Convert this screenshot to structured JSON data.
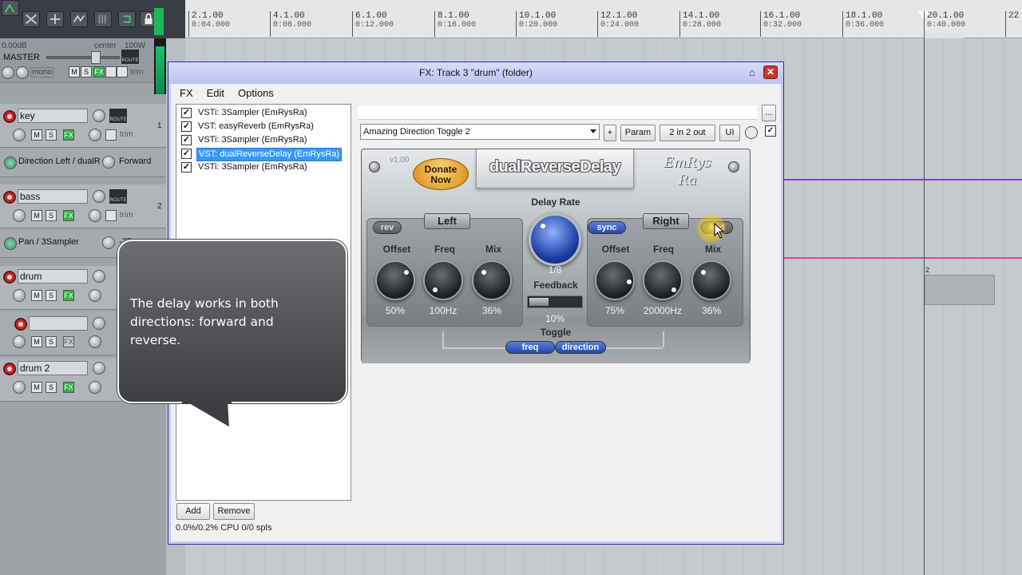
{
  "ruler": {
    "marks": [
      {
        "bar": "2.1.00",
        "time": "0:04.000"
      },
      {
        "bar": "4.1.00",
        "time": "0:08.000"
      },
      {
        "bar": "6.1.00",
        "time": "0:12.000"
      },
      {
        "bar": "8.1.00",
        "time": "0:16.000"
      },
      {
        "bar": "10.1.00",
        "time": "0:20.000"
      },
      {
        "bar": "12.1.00",
        "time": "0:24.000"
      },
      {
        "bar": "14.1.00",
        "time": "0:28.000"
      },
      {
        "bar": "16.1.00",
        "time": "0:32.000"
      },
      {
        "bar": "18.1.00",
        "time": "0:36.000"
      },
      {
        "bar": "20.1.00",
        "time": "0:40.000"
      },
      {
        "bar": "22",
        "time": ""
      }
    ]
  },
  "tracks": {
    "master": {
      "volume": "0.00dB",
      "pan": "center",
      "width": "100W",
      "name": "MASTER",
      "mono_label": "mono",
      "m_label": "M",
      "s_label": "S",
      "fx_label": "FX",
      "trim_label": "trim"
    },
    "key": {
      "name": "key",
      "number": "1"
    },
    "key_env": {
      "label": "Direction Left / dualR",
      "value": "Forward"
    },
    "bass": {
      "name": "bass",
      "number": "2"
    },
    "bass_env": {
      "label": "Pan / 3Sampler",
      "value": "-77"
    },
    "drum": {
      "name": "drum"
    },
    "unnamed": {
      "name": ""
    },
    "drum2": {
      "name": "drum 2"
    },
    "buttons": {
      "m": "M",
      "s": "S",
      "fx": "FX",
      "trim": "trim",
      "route": "ROUTE"
    },
    "item_number": "2"
  },
  "fxwindow": {
    "title": "FX: Track 3 \"drum\" (folder)",
    "pin_icon": "pin-icon",
    "close_label": "✕",
    "menu": [
      "FX",
      "Edit",
      "Options"
    ],
    "fx_chain": [
      {
        "label": "VSTi: 3Sampler (EmRysRa)",
        "checked": true,
        "selected": false
      },
      {
        "label": "VST: easyReverb (EmRysRa)",
        "checked": true,
        "selected": false
      },
      {
        "label": "VSTi: 3Sampler (EmRysRa)",
        "checked": true,
        "selected": false
      },
      {
        "label": "VST: dualReverseDelay (EmRysRa)",
        "checked": true,
        "selected": true
      },
      {
        "label": "VSTi: 3Sampler (EmRysRa)",
        "checked": true,
        "selected": false
      }
    ],
    "add_label": "Add",
    "remove_label": "Remove",
    "cpu": "0.0%/0.2% CPU 0/0 spls",
    "more_label": "...",
    "preset": "Amazing Direction Toggle 2",
    "plus_label": "+",
    "param_label": "Param",
    "io_label": "2 in 2 out",
    "ui_label": "UI",
    "bypass_check": "✓"
  },
  "plugin": {
    "version": "v1.00",
    "donate": "Donate Now",
    "title": "dualReverseDelay",
    "brand": "EmRys Ra",
    "delay_rate_label": "Delay Rate",
    "delay_rate_value": "1/8",
    "feedback_label": "Feedback",
    "feedback_value": "10%",
    "toggle_label": "Toggle",
    "toggle_freq": "freq",
    "toggle_direction": "direction",
    "left": {
      "title": "Left",
      "rev_label": "rev",
      "offset_label": "Offset",
      "offset_value": "50%",
      "freq_label": "Freq",
      "freq_value": "100Hz",
      "mix_label": "Mix",
      "mix_value": "36%"
    },
    "right": {
      "title": "Right",
      "sync_label": "sync",
      "fwd_label": "fwd",
      "offset_label": "Offset",
      "offset_value": "75%",
      "freq_label": "Freq",
      "freq_value": "20000Hz",
      "mix_label": "Mix",
      "mix_value": "36%"
    }
  },
  "callout": {
    "lines": [
      "The delay works in both",
      "directions: forward and",
      "reverse."
    ]
  },
  "colors": {
    "record": "#c92a2a",
    "fx_active": "#35b24a",
    "selection": "#3399ff",
    "envelope_purple": "#8a3fc6",
    "envelope_pink": "#e0409a"
  }
}
